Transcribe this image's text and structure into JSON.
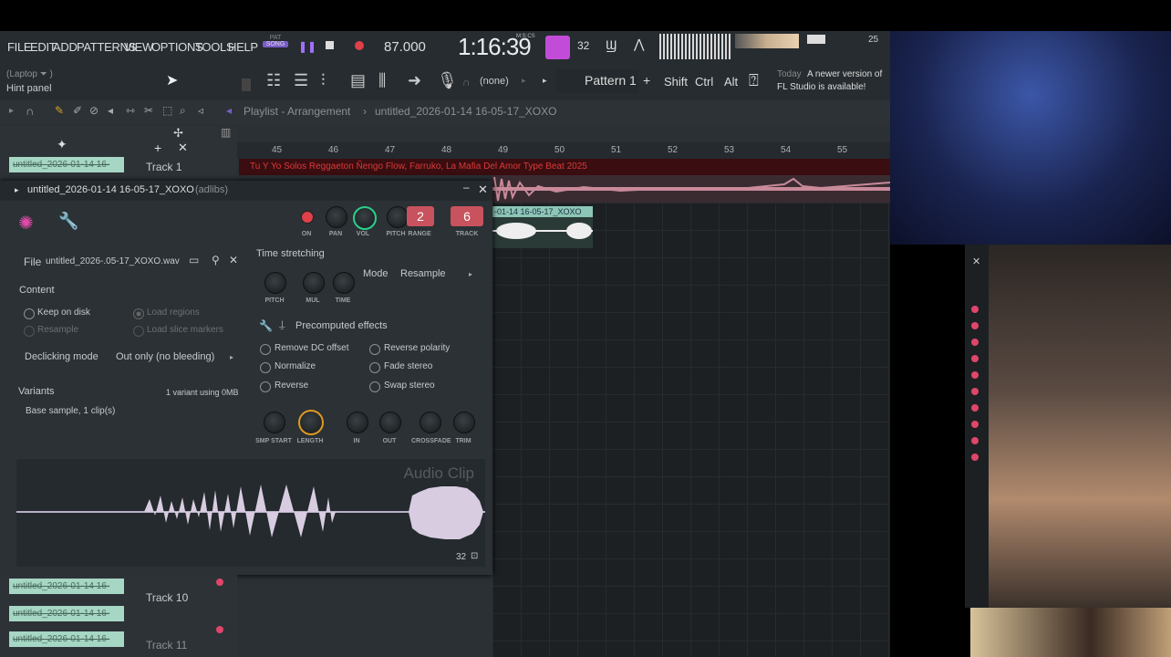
{
  "menu": [
    "FILE",
    "EDIT",
    "ADD",
    "PATTERNS",
    "VIEW",
    "OPTIONS",
    "TOOLS",
    "HELP"
  ],
  "transport": {
    "mode_top": "PAT",
    "mode_bottom": "SONG",
    "tempo": "87.000",
    "time": "1:16:39",
    "time_unit": "M:S:CS",
    "cpu": "32",
    "voices": "25"
  },
  "hint": {
    "line1": "(Laptop ⏷ )",
    "line2": "Hint panel"
  },
  "pattern": {
    "none_label": "(none)",
    "name": "Pattern 1",
    "mods": [
      "Shift",
      "Ctrl",
      "Alt"
    ]
  },
  "news": {
    "label": "Today",
    "text1": "A newer version of",
    "text2": "FL Studio is available!"
  },
  "playlist": {
    "title": "Playlist - Arrangement",
    "project": "untitled_2026-01-14 16-05-17_XOXO"
  },
  "ruler": [
    "45",
    "46",
    "47",
    "48",
    "49",
    "50",
    "51",
    "52",
    "53",
    "54",
    "55"
  ],
  "tracks": [
    {
      "clip": "untitled_2026-01-14 16-",
      "name": "Track 1"
    },
    {
      "clip": "untitled_2026-01-14 16-",
      "name": "Track 10"
    },
    {
      "clip": "untitled_2026-01-14 16-",
      "name": ""
    },
    {
      "clip": "untitled_2026-01-14 16-",
      "name": "Track 11"
    }
  ],
  "lane_title": "Tu Y Yo Solos  Reggaeton  Ñengo Flow, Farruko, La Mafia Del Amor Type Beat 2025",
  "clip_label": "-01-14 16-05-17_XOXO",
  "channel": {
    "title": "untitled_2026-01-14 16-05-17_XOXO",
    "subtitle": "(adlibs)",
    "knobs": {
      "on": "ON",
      "pan": "PAN",
      "vol": "VOL",
      "pitch": "PITCH",
      "range": "RANGE",
      "track": "TRACK",
      "range_value": "2",
      "track_value": "6"
    },
    "file_label": "File",
    "file_name": "untitled_2026-.05-17_XOXO.wav",
    "content_label": "Content",
    "keep_on_disk": "Keep on disk",
    "resample": "Resample",
    "load_regions": "Load regions",
    "load_slice_markers": "Load slice markers",
    "declicking_label": "Declicking mode",
    "declicking_value": "Out only (no bleeding)",
    "variants_label": "Variants",
    "variants_info": "1 variant using 0MB",
    "variant_item": "Base sample, 1 clip(s)",
    "time_stretching": "Time stretching",
    "ts_knobs": [
      "PITCH",
      "MUL",
      "TIME"
    ],
    "mode_label": "Mode",
    "mode_value": "Resample",
    "precomputed": "Precomputed effects",
    "effects_left": [
      "Remove DC offset",
      "Normalize",
      "Reverse"
    ],
    "effects_right": [
      "Reverse polarity",
      "Fade stereo",
      "Swap stereo"
    ],
    "bottom_knobs": [
      "SMP START",
      "LENGTH",
      "IN",
      "OUT",
      "CROSSFADE",
      "TRIM"
    ],
    "audio_clip_label": "Audio Clip",
    "zoom": "32"
  }
}
